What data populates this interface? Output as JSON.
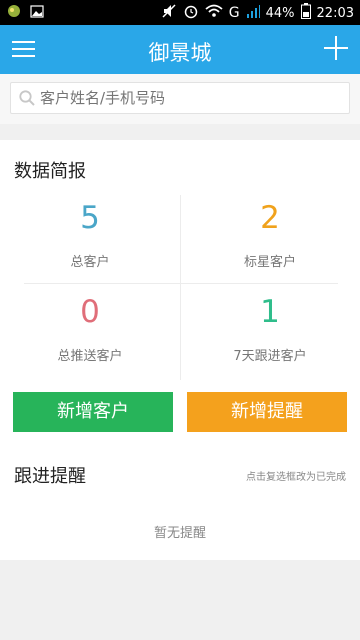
{
  "status_bar": {
    "battery_percent": "44%",
    "time": "22:03",
    "network_label": "G",
    "icons": [
      "app-icon",
      "image-icon",
      "mute-icon",
      "alarm-icon",
      "wifi-icon",
      "signal-icon",
      "battery-icon"
    ]
  },
  "app_bar": {
    "title": "御景城",
    "menu_icon": "menu-icon",
    "add_icon": "plus-icon"
  },
  "search": {
    "placeholder": "客户姓名/手机号码",
    "icon": "search-icon"
  },
  "summary": {
    "title": "数据简报",
    "stats": [
      {
        "value": "5",
        "label": "总客户",
        "color": "#4aa6c8"
      },
      {
        "value": "2",
        "label": "标星客户",
        "color": "#f0a21c"
      },
      {
        "value": "0",
        "label": "总推送客户",
        "color": "#e06e79"
      },
      {
        "value": "1",
        "label": "7天跟进客户",
        "color": "#2fbd8b"
      }
    ]
  },
  "actions": {
    "add_customer": "新增客户",
    "add_reminder": "新增提醒"
  },
  "followup": {
    "title": "跟进提醒",
    "hint": "点击复选框改为已完成",
    "empty_text": "暂无提醒"
  }
}
